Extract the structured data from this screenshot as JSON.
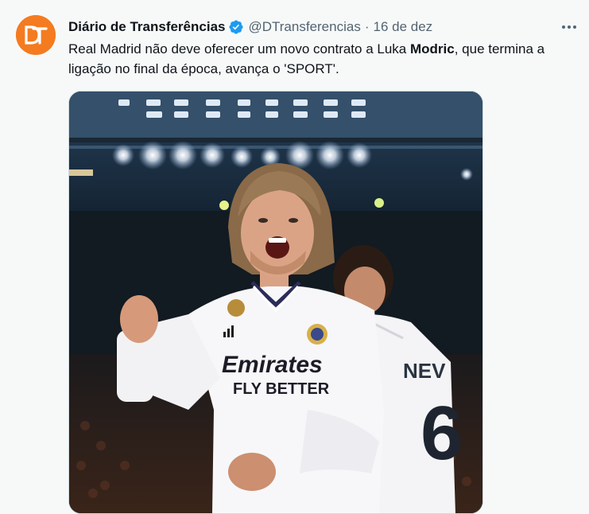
{
  "tweet": {
    "display_name": "Diário de Transferências",
    "handle": "@DTransferencias",
    "separator": "·",
    "date": "16 de dez",
    "text_part1": "Real Madrid não deve oferecer um novo contrato a Luka ",
    "text_bold": "Modric",
    "text_part2": ", que termina a ligação no final da época, avança o 'SPORT'.",
    "avatar_letters": "DT",
    "media_description": "photo-of-footballer-celebrating",
    "jersey_text_line1": "Emirates",
    "jersey_text_line2": "FLY BETTER",
    "jersey_number": "6"
  },
  "icons": {
    "verified": "verified-badge-icon",
    "more": "more-options-icon"
  },
  "colors": {
    "avatar_bg": "#f47b20",
    "verified_blue": "#1d9bf0",
    "secondary_text": "#536471",
    "background": "#f7f9f9"
  }
}
